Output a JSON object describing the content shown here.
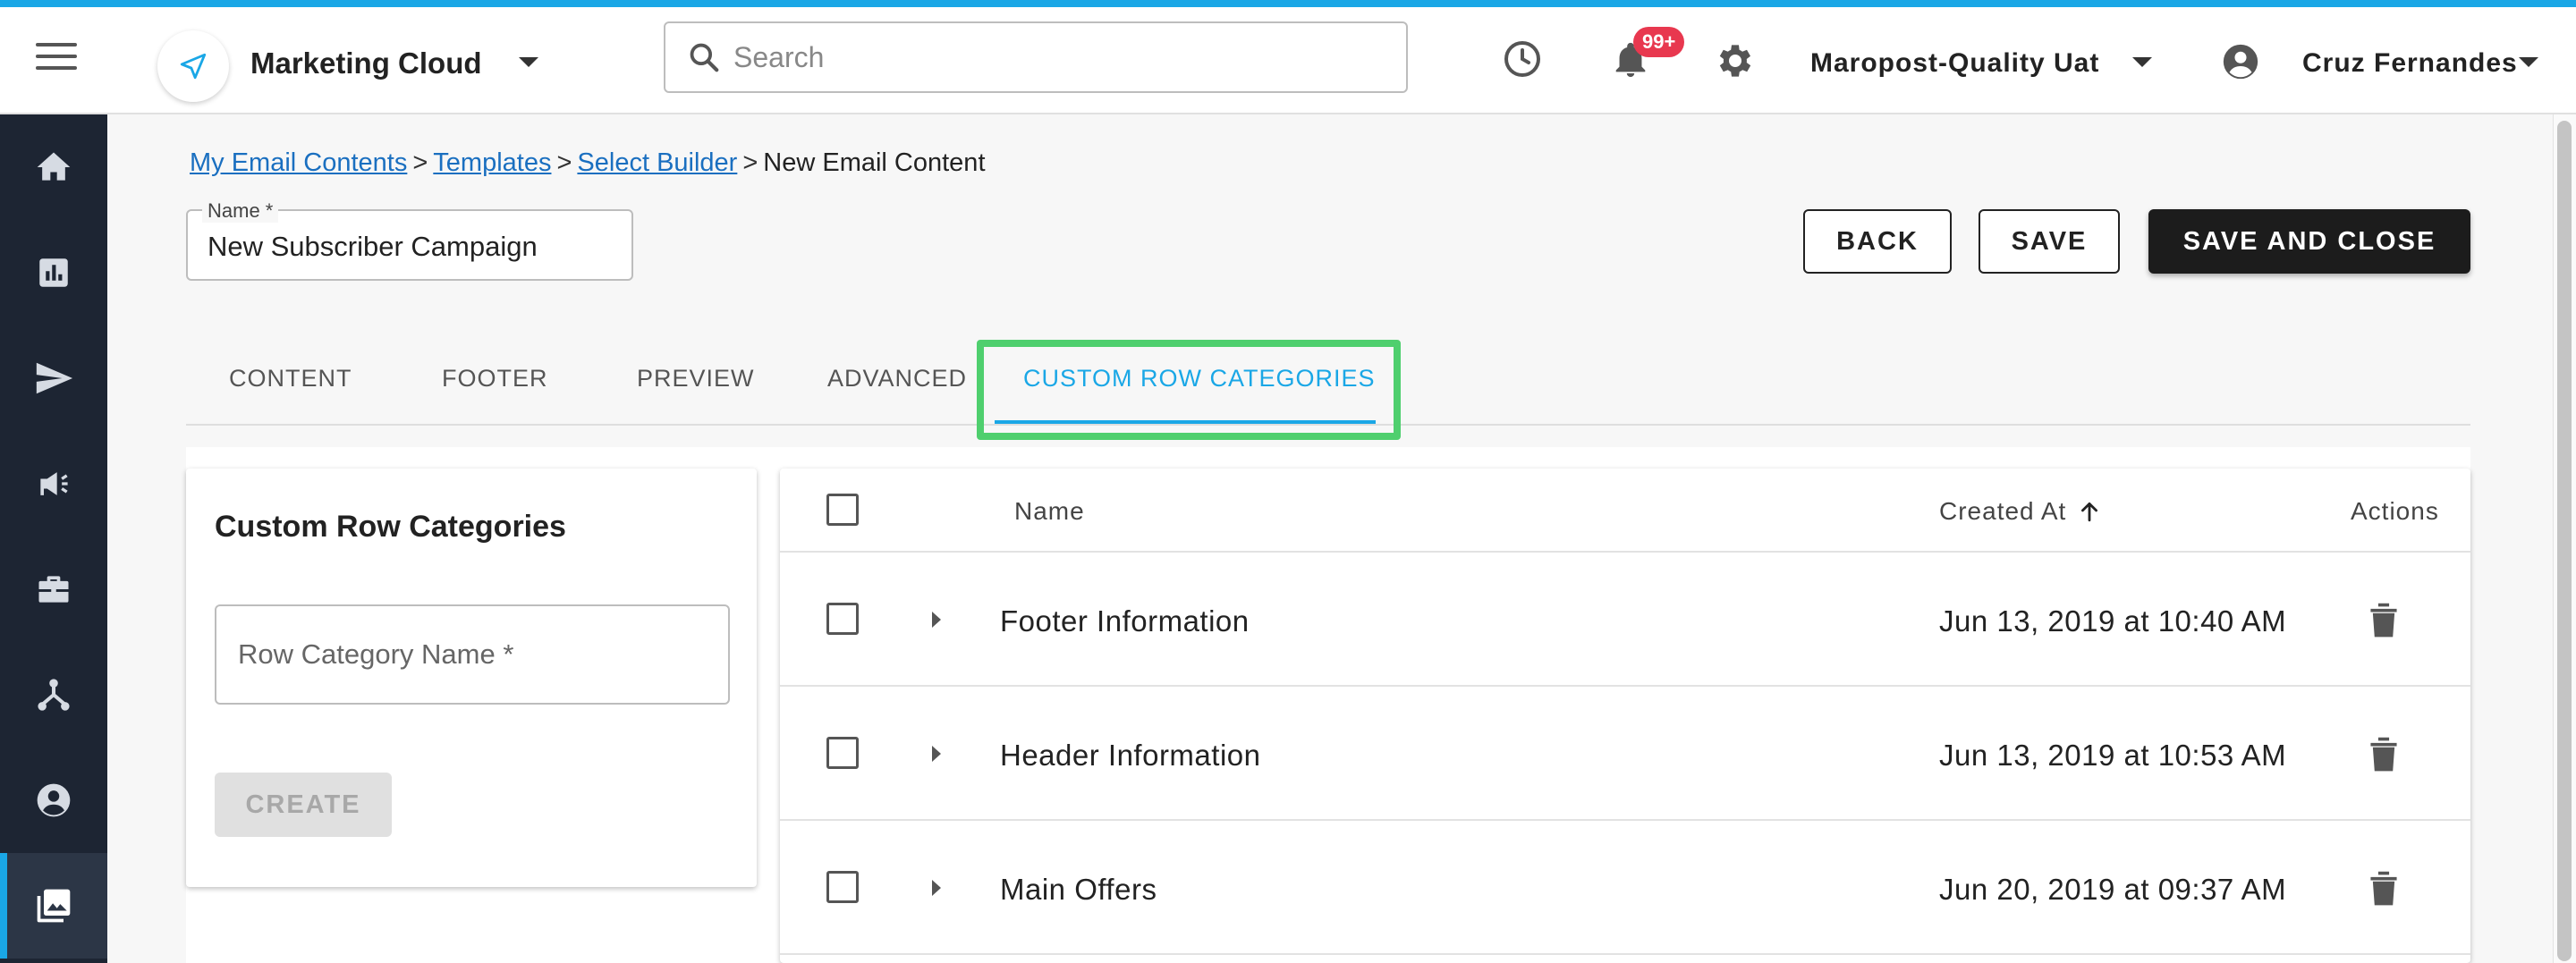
{
  "header": {
    "app_title": "Marketing Cloud",
    "search_placeholder": "Search",
    "notification_badge": "99+",
    "account_name": "Maropost-Quality Uat",
    "user_name": "Cruz Fernandes"
  },
  "sidebar": {
    "items": [
      {
        "icon": "home-icon"
      },
      {
        "icon": "reports-icon"
      },
      {
        "icon": "send-icon"
      },
      {
        "icon": "campaign-icon"
      },
      {
        "icon": "briefcase-icon"
      },
      {
        "icon": "journey-icon"
      },
      {
        "icon": "contacts-icon"
      },
      {
        "icon": "content-library-icon",
        "active": true
      }
    ]
  },
  "breadcrumb": {
    "items": [
      "My Email Contents",
      "Templates",
      "Select Builder"
    ],
    "separator": ">",
    "current": "New Email Content"
  },
  "form": {
    "name_label": "Name *",
    "name_value": "New Subscriber Campaign"
  },
  "actions": {
    "back": "BACK",
    "save": "SAVE",
    "save_and_close": "SAVE AND CLOSE"
  },
  "tabs": [
    {
      "label": "CONTENT"
    },
    {
      "label": "FOOTER"
    },
    {
      "label": "PREVIEW"
    },
    {
      "label": "ADVANCED"
    },
    {
      "label": "CUSTOM ROW CATEGORIES",
      "active": true
    }
  ],
  "custom_row_panel": {
    "title": "Custom Row Categories",
    "input_placeholder": "Row Category Name *",
    "create_label": "CREATE"
  },
  "table": {
    "columns": {
      "name": "Name",
      "created_at": "Created At",
      "actions": "Actions"
    },
    "sort": "created_at ascending",
    "rows": [
      {
        "name": "Footer Information",
        "created_at": "Jun 13, 2019 at 10:40 AM"
      },
      {
        "name": "Header Information",
        "created_at": "Jun 13, 2019 at 10:53 AM"
      },
      {
        "name": "Main Offers",
        "created_at": "Jun 20, 2019 at 09:37 AM"
      }
    ]
  },
  "colors": {
    "accent": "#1aa7e6",
    "sidebar_bg": "#1d2533",
    "highlight": "#4fcf6e",
    "badge": "#e8384f",
    "link": "#1a6fc0"
  }
}
